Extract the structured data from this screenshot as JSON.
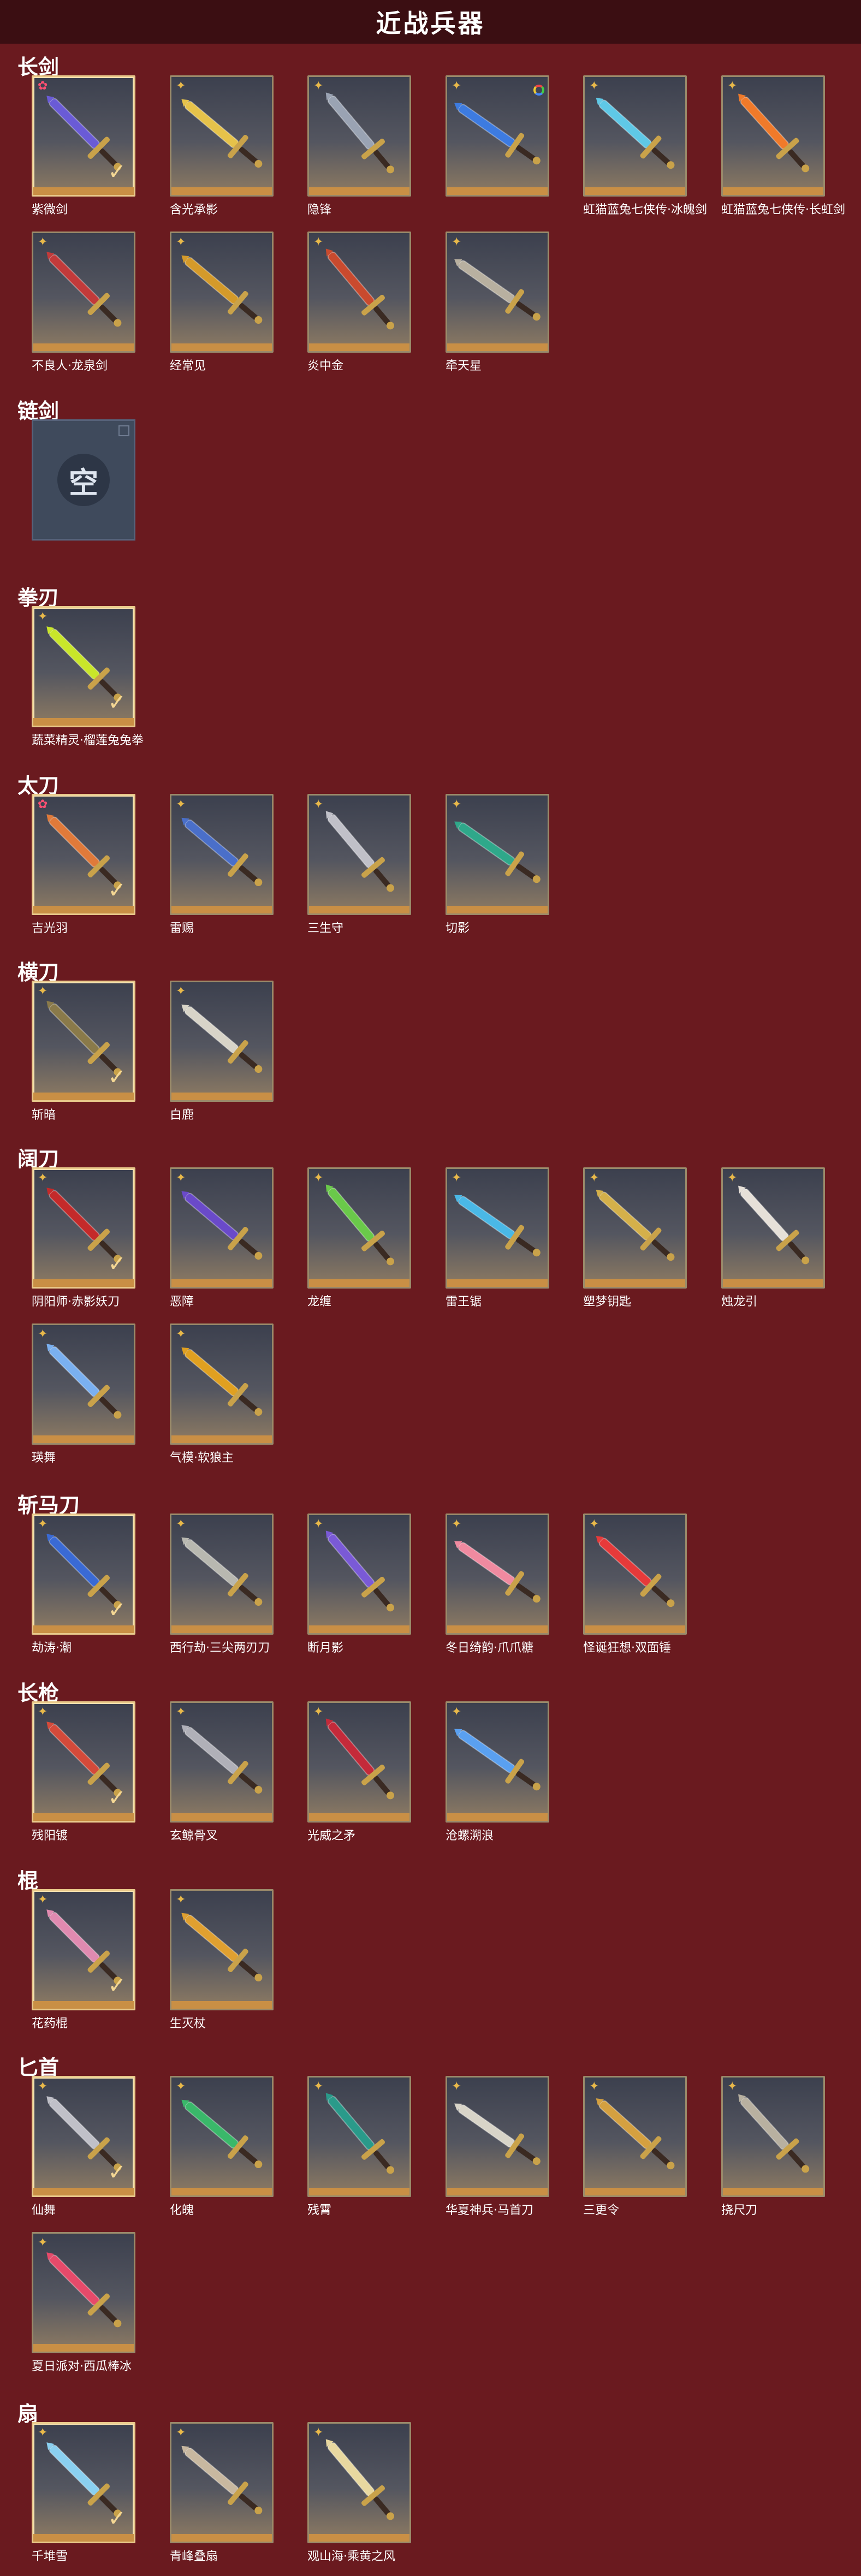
{
  "page": {
    "title": "近战兵器"
  },
  "sections": [
    {
      "title": "长剑",
      "items": [
        {
          "label": "紫微剑",
          "rarity": "pink",
          "selected": true,
          "color": "#6a5bd6"
        },
        {
          "label": "含光承影",
          "rarity": "gold",
          "color": "#e6c24a"
        },
        {
          "label": "隐锋",
          "rarity": "gold",
          "color": "#9aa3b3"
        },
        {
          "label": "",
          "rarity": "rainbow",
          "color": "#3d7be0"
        },
        {
          "label": "虹猫蓝兔七侠传·冰魄剑",
          "rarity": "gold",
          "color": "#5fc8e6"
        },
        {
          "label": "虹猫蓝兔七侠传·长虹剑",
          "rarity": "gold",
          "color": "#f07a2a"
        },
        {
          "label": "不良人·龙泉剑",
          "rarity": "gold",
          "color": "#c23a3a"
        },
        {
          "label": "经常见",
          "rarity": "gold",
          "color": "#d49a2a"
        },
        {
          "label": "炎中金",
          "rarity": "gold",
          "color": "#c94a2e"
        },
        {
          "label": "牵天星",
          "rarity": "gold",
          "color": "#b8b0a0"
        }
      ]
    },
    {
      "title": "链剑",
      "empty": true,
      "empty_text": "空"
    },
    {
      "title": "拳刃",
      "items": [
        {
          "label": "蔬菜精灵·榴莲兔兔拳",
          "rarity": "gold",
          "selected": true,
          "color": "#c9e62a"
        }
      ]
    },
    {
      "title": "太刀",
      "items": [
        {
          "label": "吉光羽",
          "rarity": "pink",
          "selected": true,
          "color": "#e07a3a"
        },
        {
          "label": "雷赐",
          "rarity": "gold",
          "color": "#4a6fc9"
        },
        {
          "label": "三生守",
          "rarity": "gold",
          "color": "#c0c0c8"
        },
        {
          "label": "切影",
          "rarity": "gold",
          "color": "#2fa88a"
        }
      ]
    },
    {
      "title": "横刀",
      "items": [
        {
          "label": "斩暗",
          "rarity": "gold",
          "selected": true,
          "color": "#8a7a4a"
        },
        {
          "label": "白鹿",
          "rarity": "gold",
          "color": "#d8d4c8"
        }
      ]
    },
    {
      "title": "阔刀",
      "items": [
        {
          "label": "阴阳师·赤影妖刀",
          "rarity": "gold",
          "selected": true,
          "color": "#c42a2a"
        },
        {
          "label": "恶障",
          "rarity": "gold",
          "color": "#6a4ac9"
        },
        {
          "label": "龙缠",
          "rarity": "gold",
          "color": "#6ac94a"
        },
        {
          "label": "雷王锯",
          "rarity": "gold",
          "color": "#4ab8e6"
        },
        {
          "label": "塑梦钥匙",
          "rarity": "gold",
          "color": "#d4b04a"
        },
        {
          "label": "烛龙引",
          "rarity": "gold",
          "color": "#e6e0d8"
        },
        {
          "label": "瑛舞",
          "rarity": "gold",
          "color": "#7ab0f0"
        },
        {
          "label": "气模·软狼主",
          "rarity": "gold",
          "color": "#e0a020"
        }
      ]
    },
    {
      "title": "斩马刀",
      "items": [
        {
          "label": "劫涛·潮",
          "rarity": "gold",
          "selected": true,
          "color": "#3a6ad4"
        },
        {
          "label": "西行劫·三尖两刃刀",
          "rarity": "gold",
          "color": "#b8b8b0"
        },
        {
          "label": "断月影",
          "rarity": "gold",
          "color": "#7a5ad6"
        },
        {
          "label": "冬日绮韵·爪爪糖",
          "rarity": "gold",
          "color": "#f08aa0"
        },
        {
          "label": "怪诞狂想·双面锤",
          "rarity": "gold",
          "color": "#e63a3a"
        }
      ]
    },
    {
      "title": "长枪",
      "items": [
        {
          "label": "残阳镀",
          "rarity": "gold",
          "selected": true,
          "color": "#d44a3a"
        },
        {
          "label": "玄鲸骨叉",
          "rarity": "gold",
          "color": "#b0b0b8"
        },
        {
          "label": "光威之矛",
          "rarity": "gold",
          "color": "#c42a3a"
        },
        {
          "label": "沧螺溯浪",
          "rarity": "gold",
          "color": "#5aa0f0"
        }
      ]
    },
    {
      "title": "棍",
      "items": [
        {
          "label": "花药棍",
          "rarity": "gold",
          "selected": true,
          "color": "#e08ab0"
        },
        {
          "label": "生灭杖",
          "rarity": "gold",
          "color": "#e0a030"
        }
      ]
    },
    {
      "title": "匕首",
      "items": [
        {
          "label": "仙舞",
          "rarity": "gold",
          "selected": true,
          "color": "#c0c0c8"
        },
        {
          "label": "化魄",
          "rarity": "gold",
          "color": "#3ab86a"
        },
        {
          "label": "残霄",
          "rarity": "gold",
          "color": "#2a9a8a"
        },
        {
          "label": "华夏神兵·马首刀",
          "rarity": "gold",
          "color": "#d8d4c8"
        },
        {
          "label": "三更令",
          "rarity": "gold",
          "color": "#d4a040"
        },
        {
          "label": "挠尺刀",
          "rarity": "gold",
          "color": "#b8b0a0"
        },
        {
          "label": "夏日派对·西瓜棒冰",
          "rarity": "gold",
          "color": "#e64a6a"
        }
      ]
    },
    {
      "title": "扇",
      "items": [
        {
          "label": "千堆雪",
          "rarity": "gold",
          "selected": true,
          "color": "#8ad0f0"
        },
        {
          "label": "青峰叠扇",
          "rarity": "gold",
          "color": "#c8b8a0"
        },
        {
          "label": "观山海·乘黄之风",
          "rarity": "gold",
          "color": "#e8d8a0"
        }
      ]
    }
  ]
}
